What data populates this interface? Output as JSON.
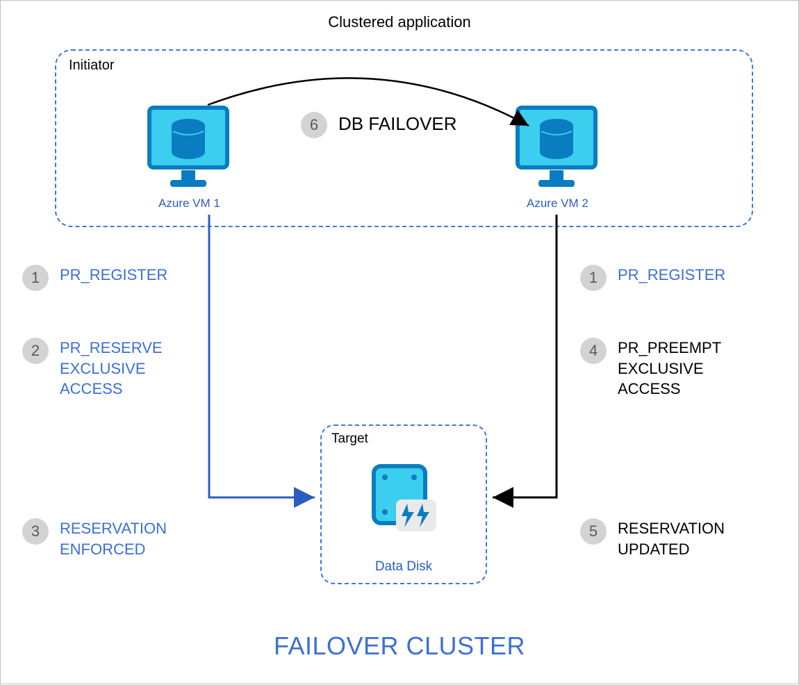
{
  "title": "Clustered application",
  "initiator_label": "Initiator",
  "vm1_label": "Azure VM 1",
  "vm2_label": "Azure VM 2",
  "target_label": "Target",
  "disk_label": "Data Disk",
  "footer": "FAILOVER CLUSTER",
  "steps": {
    "s1": "PR_REGISTER",
    "s2": "PR_RESERVE\nEXCLUSIVE\nACCESS",
    "s3": "RESERVATION\nENFORCED",
    "s1b": "PR_REGISTER",
    "s4": "PR_PREEMPT\nEXCLUSIVE\nACCESS",
    "s5": "RESERVATION\nUPDATED",
    "s6": "DB FAILOVER"
  },
  "badges": {
    "n1": "1",
    "n2": "2",
    "n3": "3",
    "n4": "4",
    "n5": "5",
    "n6": "6"
  },
  "colors": {
    "azure_blue": "#3a6fd6",
    "cyan_fill": "#3cceee",
    "badge_bg": "#d3d3d3"
  }
}
